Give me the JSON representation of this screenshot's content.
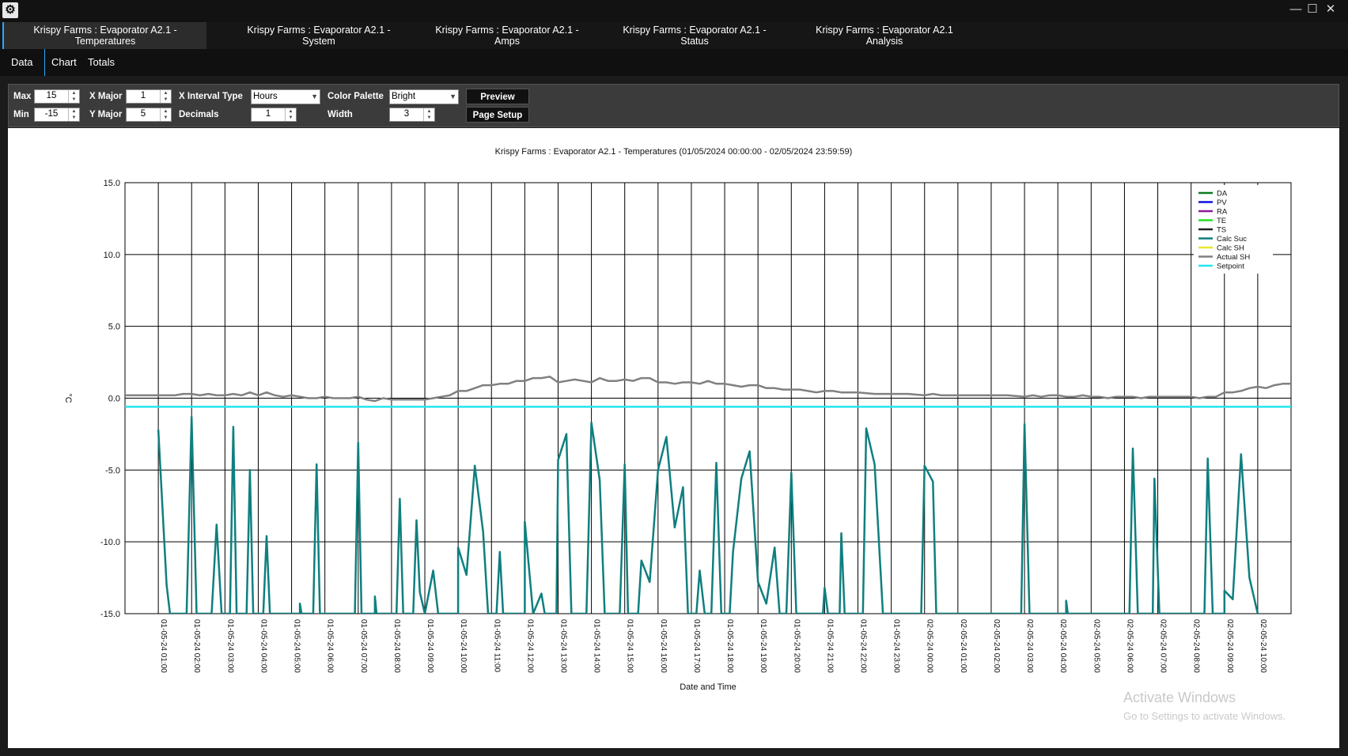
{
  "window": {
    "minimize": "—",
    "maximize": "☐",
    "close": "✕"
  },
  "doc_tabs": [
    {
      "label": "Krispy Farms : Evaporator A2.1 -\nTemperatures"
    },
    {
      "label": "Krispy Farms : Evaporator A2.1 -\nSystem"
    },
    {
      "label": "Krispy Farms : Evaporator A2.1 -\nAmps"
    },
    {
      "label": "Krispy Farms : Evaporator A2.1 -\nStatus"
    },
    {
      "label": "Krispy Farms : Evaporator A2.1\nAnalysis"
    }
  ],
  "sub_tabs": [
    {
      "label": "Data"
    },
    {
      "label": "Chart"
    },
    {
      "label": "Totals"
    }
  ],
  "toolbar": {
    "max_label": "Max",
    "max_value": "15",
    "min_label": "Min",
    "min_value": "-15",
    "xmajor_label": "X Major",
    "xmajor_value": "1",
    "ymajor_label": "Y Major",
    "ymajor_value": "5",
    "xinterval_label": "X Interval Type",
    "xinterval_value": "Hours",
    "decimals_label": "Decimals",
    "decimals_value": "1",
    "palette_label": "Color Palette",
    "palette_value": "Bright",
    "width_label": "Width",
    "width_value": "3",
    "preview_label": "Preview",
    "page_setup_label": "Page Setup"
  },
  "watermark": {
    "line1": "Activate Windows",
    "line2": "Go to Settings to activate Windows."
  },
  "chart_data": {
    "type": "line",
    "title": "Krispy Farms : Evaporator A2.1 - Temperatures (01/05/2024 00:00:00 - 02/05/2024 23:59:59)",
    "xlabel": "Date and Time",
    "ylabel": "°C",
    "ylim": [
      -15,
      15
    ],
    "y_ticks": [
      "15.0",
      "10.0",
      "5.0",
      "0.0",
      "-5.0",
      "-10.0",
      "-15.0"
    ],
    "x_ticks": [
      "01-05-24 01:00",
      "01-05-24 02:00",
      "01-05-24 03:00",
      "01-05-24 04:00",
      "01-05-24 05:00",
      "01-05-24 06:00",
      "01-05-24 07:00",
      "01-05-24 08:00",
      "01-05-24 09:00",
      "01-05-24 10:00",
      "01-05-24 11:00",
      "01-05-24 12:00",
      "01-05-24 13:00",
      "01-05-24 14:00",
      "01-05-24 15:00",
      "01-05-24 16:00",
      "01-05-24 17:00",
      "01-05-24 18:00",
      "01-05-24 19:00",
      "01-05-24 20:00",
      "01-05-24 21:00",
      "01-05-24 22:00",
      "01-05-24 23:00",
      "02-05-24 00:00",
      "02-05-24 01:00",
      "02-05-24 02:00",
      "02-05-24 03:00",
      "02-05-24 04:00",
      "02-05-24 05:00",
      "02-05-24 06:00",
      "02-05-24 07:00",
      "02-05-24 08:00",
      "02-05-24 09:00",
      "02-05-24 10:00"
    ],
    "x_range_hours": [
      0,
      34
    ],
    "grid": true,
    "legend_position": "top-right",
    "series": [
      {
        "name": "DA",
        "color": "#0a7a1e",
        "points": []
      },
      {
        "name": "PV",
        "color": "#1010e0",
        "points": []
      },
      {
        "name": "RA",
        "color": "#8a1a9a",
        "points": []
      },
      {
        "name": "TE",
        "color": "#22e022",
        "points": []
      },
      {
        "name": "TS",
        "color": "#222222",
        "points": []
      },
      {
        "name": "Calc Suc",
        "color": "#0f7f7f",
        "points": [
          [
            0,
            -2.2
          ],
          [
            0.25,
            -13
          ],
          [
            0.35,
            -15
          ],
          [
            0.85,
            -15
          ],
          [
            1.0,
            -1.3
          ],
          [
            1.15,
            -15
          ],
          [
            1.6,
            -15
          ],
          [
            1.75,
            -8.8
          ],
          [
            1.9,
            -15
          ],
          [
            2.15,
            -15
          ],
          [
            2.25,
            -2.0
          ],
          [
            2.35,
            -15
          ],
          [
            2.65,
            -15
          ],
          [
            2.75,
            -5.0
          ],
          [
            2.85,
            -15
          ],
          [
            3.15,
            -15
          ],
          [
            3.25,
            -9.6
          ],
          [
            3.35,
            -15
          ],
          [
            4.25,
            -15
          ],
          [
            4.25,
            -14.3
          ],
          [
            4.3,
            -15
          ],
          [
            4.65,
            -15
          ],
          [
            4.75,
            -4.6
          ],
          [
            4.85,
            -15
          ],
          [
            5.9,
            -15
          ],
          [
            6.0,
            -3.1
          ],
          [
            6.1,
            -15
          ],
          [
            6.5,
            -15
          ],
          [
            6.5,
            -13.8
          ],
          [
            6.55,
            -15
          ],
          [
            7.15,
            -15
          ],
          [
            7.25,
            -7.0
          ],
          [
            7.35,
            -15
          ],
          [
            7.65,
            -15
          ],
          [
            7.75,
            -8.5
          ],
          [
            7.85,
            -13.5
          ],
          [
            8.0,
            -15
          ],
          [
            8.25,
            -12.0
          ],
          [
            8.4,
            -15
          ],
          [
            9.0,
            -15
          ],
          [
            9.0,
            -10.4
          ],
          [
            9.25,
            -12.3
          ],
          [
            9.5,
            -4.7
          ],
          [
            9.75,
            -9.3
          ],
          [
            9.9,
            -15
          ],
          [
            10.15,
            -15
          ],
          [
            10.25,
            -10.7
          ],
          [
            10.35,
            -15
          ],
          [
            11.0,
            -15
          ],
          [
            11.0,
            -8.6
          ],
          [
            11.25,
            -15
          ],
          [
            11.5,
            -13.6
          ],
          [
            11.6,
            -15
          ],
          [
            11.95,
            -15
          ],
          [
            12.0,
            -4.3
          ],
          [
            12.25,
            -2.5
          ],
          [
            12.4,
            -15
          ],
          [
            12.85,
            -15
          ],
          [
            13.0,
            -1.7
          ],
          [
            13.25,
            -5.7
          ],
          [
            13.4,
            -15
          ],
          [
            13.85,
            -15
          ],
          [
            14.0,
            -4.6
          ],
          [
            14.1,
            -15
          ],
          [
            14.4,
            -15
          ],
          [
            14.5,
            -11.3
          ],
          [
            14.75,
            -12.8
          ],
          [
            15.0,
            -5.0
          ],
          [
            15.25,
            -2.7
          ],
          [
            15.5,
            -9.0
          ],
          [
            15.75,
            -6.2
          ],
          [
            15.9,
            -15
          ],
          [
            16.15,
            -15
          ],
          [
            16.25,
            -12.0
          ],
          [
            16.4,
            -15
          ],
          [
            16.6,
            -15
          ],
          [
            16.75,
            -4.5
          ],
          [
            16.9,
            -15
          ],
          [
            17.15,
            -15
          ],
          [
            17.25,
            -10.7
          ],
          [
            17.5,
            -5.6
          ],
          [
            17.75,
            -3.7
          ],
          [
            18.0,
            -12.8
          ],
          [
            18.25,
            -14.3
          ],
          [
            18.5,
            -10.4
          ],
          [
            18.65,
            -15
          ],
          [
            18.85,
            -15
          ],
          [
            19.0,
            -5.2
          ],
          [
            19.15,
            -15
          ],
          [
            19.95,
            -15
          ],
          [
            20.0,
            -13.2
          ],
          [
            20.1,
            -15
          ],
          [
            20.45,
            -15
          ],
          [
            20.5,
            -9.4
          ],
          [
            20.6,
            -15
          ],
          [
            21.15,
            -15
          ],
          [
            21.25,
            -2.1
          ],
          [
            21.5,
            -4.6
          ],
          [
            21.75,
            -15
          ],
          [
            22.9,
            -15
          ],
          [
            23.0,
            -4.7
          ],
          [
            23.25,
            -5.8
          ],
          [
            23.35,
            -15
          ],
          [
            25.9,
            -15
          ],
          [
            26.0,
            -1.8
          ],
          [
            26.15,
            -15
          ],
          [
            27.25,
            -15
          ],
          [
            27.25,
            -14.1
          ],
          [
            27.3,
            -15
          ],
          [
            29.15,
            -15
          ],
          [
            29.25,
            -3.5
          ],
          [
            29.4,
            -15
          ],
          [
            29.85,
            -15
          ],
          [
            29.9,
            -5.6
          ],
          [
            30.05,
            -15
          ],
          [
            31.4,
            -15
          ],
          [
            31.5,
            -4.2
          ],
          [
            31.65,
            -15
          ],
          [
            32.0,
            -15
          ],
          [
            32.0,
            -13.4
          ],
          [
            32.25,
            -14.0
          ],
          [
            32.5,
            -3.9
          ],
          [
            32.75,
            -12.5
          ],
          [
            33.0,
            -15
          ]
        ]
      },
      {
        "name": "Calc SH",
        "color": "#e8e830",
        "points": []
      },
      {
        "name": "Actual SH",
        "color": "#808080",
        "points": [
          [
            -1,
            0.2
          ],
          [
            0,
            0.2
          ],
          [
            0.5,
            0.2
          ],
          [
            0.75,
            0.3
          ],
          [
            1.0,
            0.3
          ],
          [
            1.25,
            0.2
          ],
          [
            1.5,
            0.3
          ],
          [
            1.75,
            0.2
          ],
          [
            2.0,
            0.2
          ],
          [
            2.25,
            0.3
          ],
          [
            2.5,
            0.2
          ],
          [
            2.75,
            0.4
          ],
          [
            3.0,
            0.2
          ],
          [
            3.25,
            0.4
          ],
          [
            3.5,
            0.2
          ],
          [
            3.75,
            0.1
          ],
          [
            4.0,
            0.2
          ],
          [
            4.25,
            0.1
          ],
          [
            4.5,
            0.0
          ],
          [
            4.75,
            0.0
          ],
          [
            5.0,
            0.1
          ],
          [
            5.25,
            0.0
          ],
          [
            5.75,
            0.0
          ],
          [
            6.0,
            0.1
          ],
          [
            6.25,
            -0.1
          ],
          [
            6.5,
            -0.2
          ],
          [
            6.75,
            0.0
          ],
          [
            7.0,
            -0.1
          ],
          [
            7.5,
            -0.1
          ],
          [
            8.0,
            -0.1
          ],
          [
            8.25,
            0.0
          ],
          [
            8.5,
            0.1
          ],
          [
            8.75,
            0.2
          ],
          [
            9.0,
            0.5
          ],
          [
            9.25,
            0.5
          ],
          [
            9.5,
            0.7
          ],
          [
            9.75,
            0.9
          ],
          [
            10.0,
            0.9
          ],
          [
            10.25,
            1.0
          ],
          [
            10.5,
            1.0
          ],
          [
            10.75,
            1.2
          ],
          [
            11.0,
            1.2
          ],
          [
            11.25,
            1.4
          ],
          [
            11.5,
            1.4
          ],
          [
            11.75,
            1.5
          ],
          [
            12.0,
            1.1
          ],
          [
            12.25,
            1.2
          ],
          [
            12.5,
            1.3
          ],
          [
            12.75,
            1.2
          ],
          [
            13.0,
            1.1
          ],
          [
            13.25,
            1.4
          ],
          [
            13.5,
            1.2
          ],
          [
            13.75,
            1.2
          ],
          [
            14.0,
            1.3
          ],
          [
            14.25,
            1.2
          ],
          [
            14.5,
            1.4
          ],
          [
            14.75,
            1.4
          ],
          [
            15.0,
            1.1
          ],
          [
            15.25,
            1.1
          ],
          [
            15.5,
            1.0
          ],
          [
            15.75,
            1.1
          ],
          [
            16.0,
            1.1
          ],
          [
            16.25,
            1.0
          ],
          [
            16.5,
            1.2
          ],
          [
            16.75,
            1.0
          ],
          [
            17.0,
            1.0
          ],
          [
            17.25,
            0.9
          ],
          [
            17.5,
            0.8
          ],
          [
            17.75,
            0.9
          ],
          [
            18.0,
            0.9
          ],
          [
            18.25,
            0.7
          ],
          [
            18.5,
            0.7
          ],
          [
            18.75,
            0.6
          ],
          [
            19.0,
            0.6
          ],
          [
            19.25,
            0.6
          ],
          [
            19.5,
            0.5
          ],
          [
            19.75,
            0.4
          ],
          [
            20.0,
            0.5
          ],
          [
            20.25,
            0.5
          ],
          [
            20.5,
            0.4
          ],
          [
            20.75,
            0.4
          ],
          [
            21.0,
            0.4
          ],
          [
            21.5,
            0.3
          ],
          [
            22.0,
            0.3
          ],
          [
            22.5,
            0.3
          ],
          [
            23.0,
            0.2
          ],
          [
            23.25,
            0.3
          ],
          [
            23.5,
            0.2
          ],
          [
            24,
            0.2
          ],
          [
            25,
            0.2
          ],
          [
            25.5,
            0.2
          ],
          [
            26.0,
            0.1
          ],
          [
            26.25,
            0.2
          ],
          [
            26.5,
            0.1
          ],
          [
            26.75,
            0.2
          ],
          [
            27.0,
            0.2
          ],
          [
            27.25,
            0.1
          ],
          [
            27.5,
            0.1
          ],
          [
            27.75,
            0.2
          ],
          [
            28.0,
            0.1
          ],
          [
            28.25,
            0.1
          ],
          [
            28.5,
            0.0
          ],
          [
            28.75,
            0.1
          ],
          [
            29.0,
            0.1
          ],
          [
            29.25,
            0.1
          ],
          [
            29.5,
            0.0
          ],
          [
            29.75,
            0.1
          ],
          [
            30.0,
            0.1
          ],
          [
            30.5,
            0.1
          ],
          [
            31.0,
            0.1
          ],
          [
            31.25,
            0.0
          ],
          [
            31.5,
            0.1
          ],
          [
            31.75,
            0.1
          ],
          [
            32.0,
            0.4
          ],
          [
            32.25,
            0.4
          ],
          [
            32.5,
            0.5
          ],
          [
            32.75,
            0.7
          ],
          [
            33.0,
            0.8
          ],
          [
            33.25,
            0.7
          ],
          [
            33.5,
            0.9
          ],
          [
            33.75,
            1.0
          ],
          [
            34.0,
            1.0
          ]
        ]
      },
      {
        "name": "Setpoint",
        "color": "#22e6ee",
        "points": [
          [
            -1,
            -0.6
          ],
          [
            34,
            -0.6
          ]
        ]
      }
    ]
  }
}
